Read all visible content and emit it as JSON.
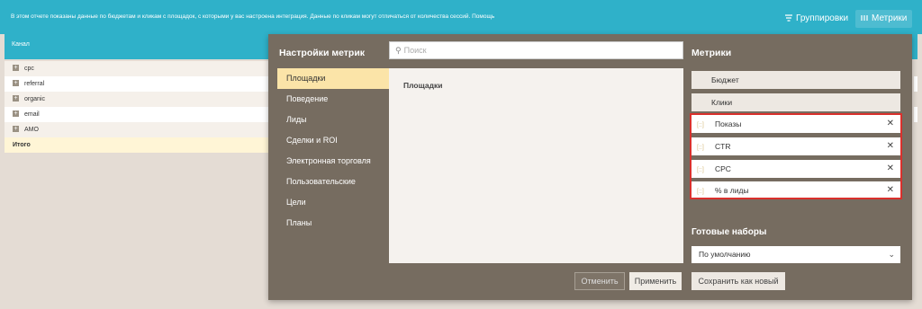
{
  "topbar": {
    "info": "В этом отчете показаны данные по бюджетам и кликам с площадок, с которыми у вас настроена интеграция. Данные по кликам могут отличаться от количества сессий. Помощь",
    "groupings_label": "Группировки",
    "metrics_label": "Метрики"
  },
  "table": {
    "column_header": "Канал",
    "rows": [
      "cpc",
      "referral",
      "organic",
      "email",
      "AMO"
    ],
    "total_label": "Итого"
  },
  "modal": {
    "title": "Настройки метрик",
    "search_placeholder": "Поиск",
    "categories": [
      "Площадки",
      "Поведение",
      "Лиды",
      "Сделки и ROI",
      "Электронная торговля",
      "Пользовательские",
      "Цели",
      "Планы"
    ],
    "center_heading": "Площадки",
    "metrics_title": "Метрики",
    "fixed_metrics": [
      "Бюджет",
      "Клики"
    ],
    "removable_metrics": [
      "Показы",
      "CTR",
      "CPC",
      "% в лиды"
    ],
    "presets_title": "Готовые наборы",
    "preset_selected": "По умолчанию",
    "cancel_label": "Отменить",
    "apply_label": "Применить",
    "save_new_label": "Сохранить как новый"
  },
  "colors": {
    "header_blue": "#2fb1c9",
    "modal_bg": "#766c60",
    "active_item": "#fbe4a8",
    "highlight_red": "#d9302c"
  },
  "icons": {
    "groupings": "filter-lines-icon",
    "metrics": "columns-icon",
    "search": "search-icon",
    "drag": "drag-handle-icon",
    "remove": "close-icon",
    "dropdown": "chevron-down-icon"
  }
}
